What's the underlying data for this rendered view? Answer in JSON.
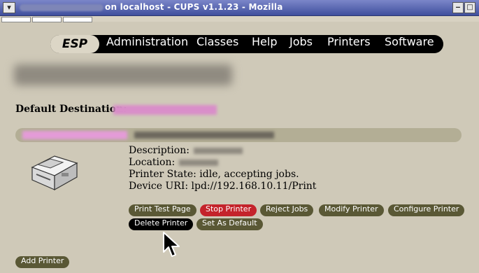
{
  "window": {
    "title": "on localhost - CUPS v1.1.23 - Mozilla",
    "sys_menu_glyph": "▾",
    "minimize_glyph": "‒",
    "maximize_glyph": "□",
    "close_glyph": "✕"
  },
  "nav": {
    "brand": "ESP",
    "items": [
      "Administration",
      "Classes",
      "Help",
      "Jobs",
      "Printers",
      "Software"
    ]
  },
  "page": {
    "default_destination_label": "Default Destination:"
  },
  "printer": {
    "description_label": "Description:",
    "location_label": "Location:",
    "state_text": "Printer State: idle, accepting jobs.",
    "device_uri_text": "Device URI: lpd://192.168.10.11/Print"
  },
  "actions": {
    "print_test_page": "Print Test Page",
    "stop_printer": "Stop Printer",
    "reject_jobs": "Reject Jobs",
    "modify_printer": "Modify Printer",
    "configure_printer": "Configure Printer",
    "delete_printer": "Delete Printer",
    "set_as_default": "Set As Default",
    "add_printer": "Add Printer"
  },
  "colors": {
    "titlebar": "#3f4f9d",
    "nav_bg": "#000000",
    "button_bg": "#5a5835",
    "stop_button": "#c4232b",
    "link_redacted": "#d98ec9"
  },
  "icons": {
    "printer": "printer-icon",
    "cursor": "mouse-pointer-icon"
  }
}
